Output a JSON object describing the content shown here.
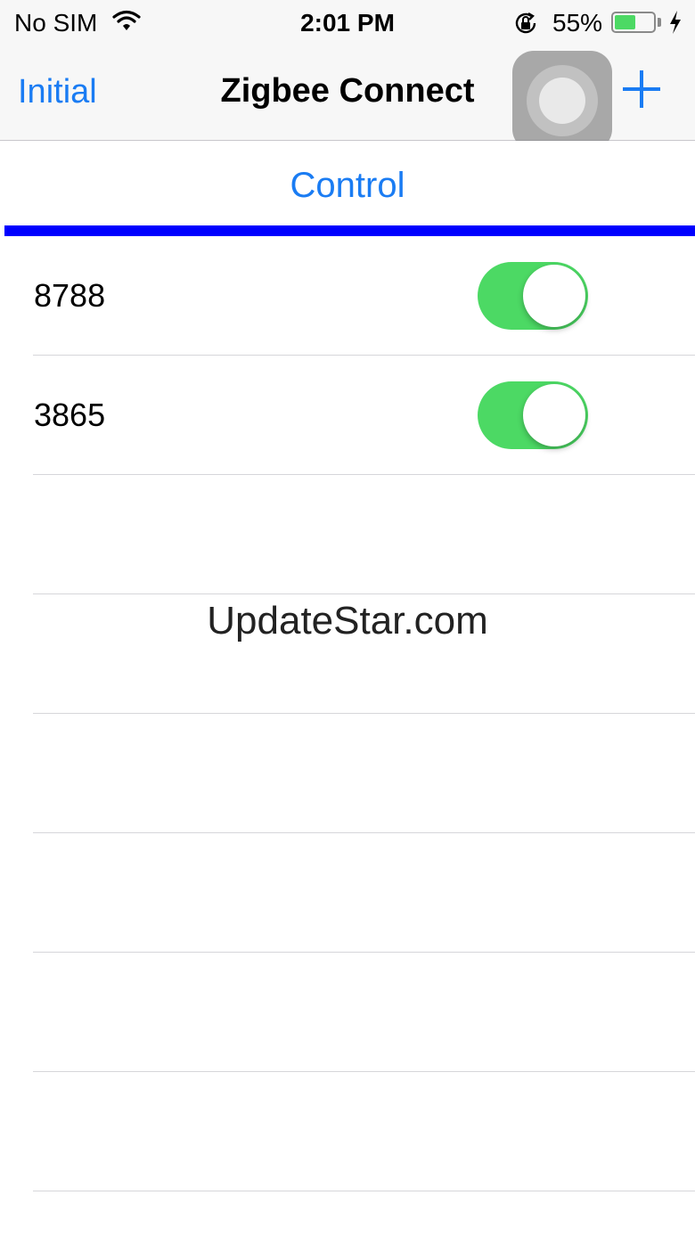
{
  "status_bar": {
    "carrier": "No SIM",
    "time": "2:01 PM",
    "battery_percent": "55%",
    "battery_level": 0.55,
    "icons": [
      "wifi-icon",
      "rotation-lock-icon",
      "battery-icon",
      "charging-bolt-icon"
    ]
  },
  "nav": {
    "back_label": "Initial",
    "title": "Zigbee Connect",
    "add_icon": "plus-icon",
    "assistive_touch_icon": "assistive-touch-icon"
  },
  "segment": {
    "tabs": [
      {
        "label": "Control",
        "selected": true
      }
    ],
    "indicator_color": "#0000ff"
  },
  "devices": [
    {
      "name": "8788",
      "on": true
    },
    {
      "name": "3865",
      "on": true
    }
  ],
  "watermark": "UpdateStar.com",
  "colors": {
    "accent": "#1a7cf3",
    "toggle_on": "#4cd964",
    "battery_fill": "#4cd964"
  }
}
